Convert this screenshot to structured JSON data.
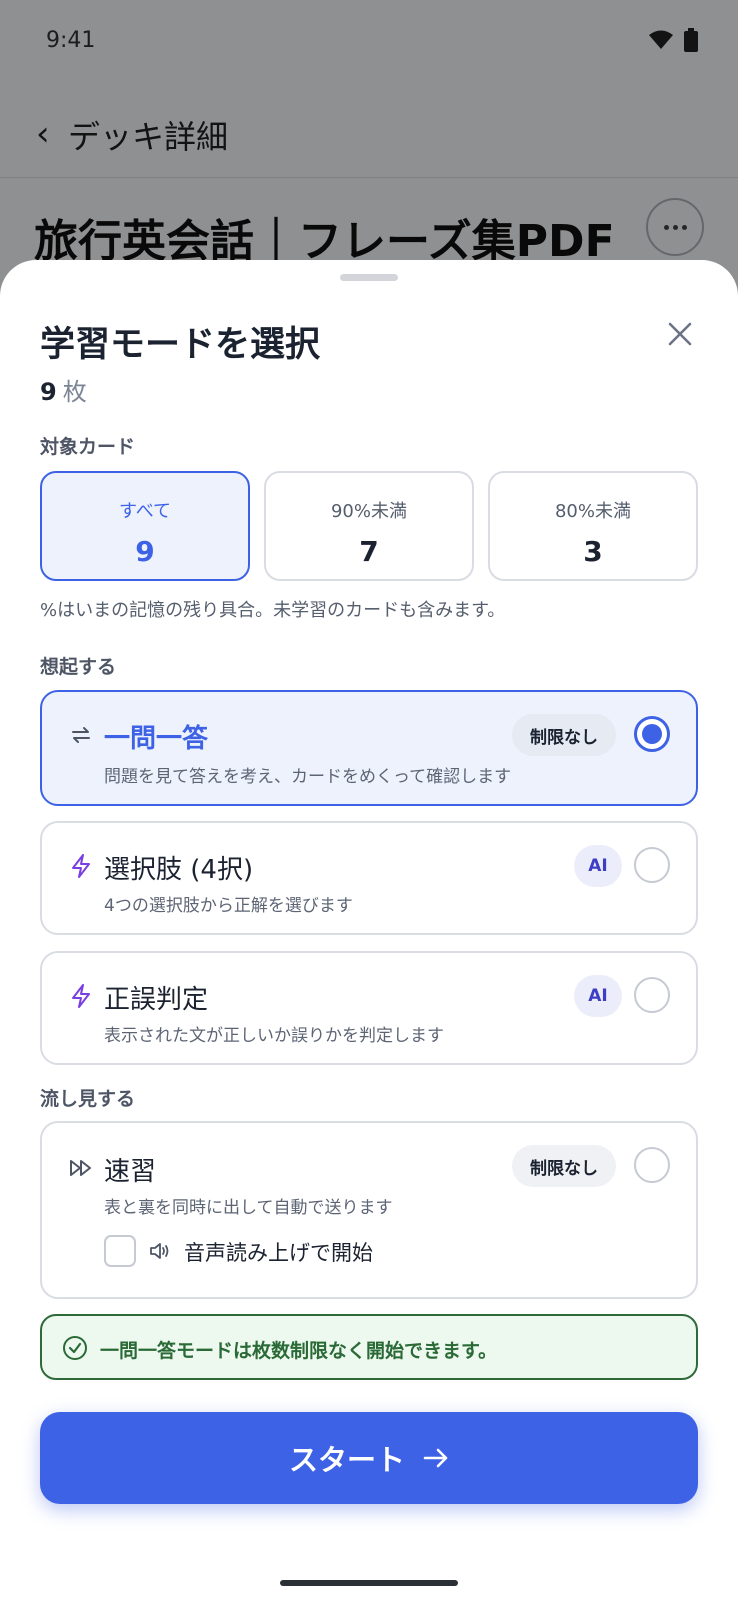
{
  "status_bar": {
    "time": "9:41"
  },
  "background": {
    "header_title": "デッキ詳細",
    "deck_title": "旅行英会話｜フレーズ集PDF"
  },
  "sheet": {
    "title": "学習モードを選択",
    "count_value": "9",
    "count_unit": "枚",
    "target_label": "対象カード",
    "targets": [
      {
        "label": "すべて",
        "value": "9",
        "selected": true
      },
      {
        "label": "90%未満",
        "value": "7",
        "selected": false
      },
      {
        "label": "80%未満",
        "value": "3",
        "selected": false
      }
    ],
    "target_note": "%はいまの記憶の残り具合。未学習のカードも含みます。",
    "recall_label": "想起する",
    "modes": [
      {
        "icon": "repeat-icon",
        "name": "一問一答",
        "desc": "問題を見て答えを考え、カードをめくって確認します",
        "badge": "制限なし",
        "selected": true
      },
      {
        "icon": "lightning-icon",
        "name": "選択肢 (4択)",
        "desc": "4つの選択肢から正解を選びます",
        "badge": "AI",
        "selected": false
      },
      {
        "icon": "lightning-icon",
        "name": "正誤判定",
        "desc": "表示された文が正しいか誤りかを判定します",
        "badge": "AI",
        "selected": false
      }
    ],
    "skim_label": "流し見する",
    "skim_mode": {
      "icon": "fast-forward-icon",
      "name": "速習",
      "desc": "表と裏を同時に出して自動で送ります",
      "badge": "制限なし",
      "selected": false,
      "tts_label": "音声読み上げで開始",
      "tts_checked": false
    },
    "info_text": "一問一答モードは枚数制限なく開始できます。",
    "start_label": "スタート"
  },
  "colors": {
    "accent": "#3e62e6",
    "selected_bg": "#eef2fd",
    "ai_icon": "#7a3fe0",
    "success_border": "#2e6a3a",
    "success_bg": "#edf8ef"
  }
}
